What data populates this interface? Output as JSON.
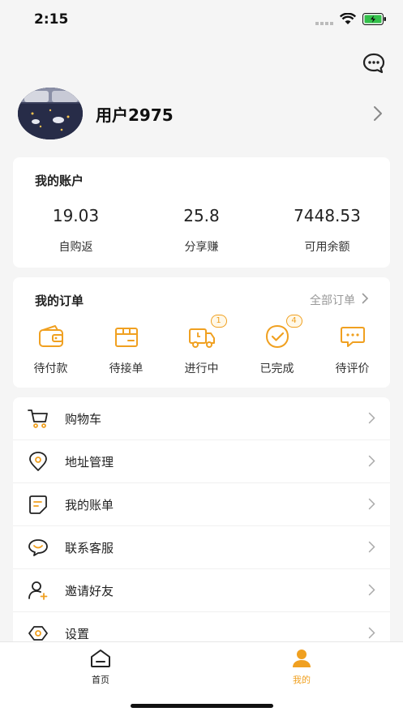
{
  "status": {
    "time": "2:15"
  },
  "profile": {
    "username": "用户2975"
  },
  "account": {
    "title": "我的账户",
    "stats": [
      {
        "value": "19.03",
        "label": "自购返"
      },
      {
        "value": "25.8",
        "label": "分享赚"
      },
      {
        "value": "7448.53",
        "label": "可用余额"
      }
    ]
  },
  "orders": {
    "title": "我的订单",
    "all_label": "全部订单",
    "items": [
      {
        "label": "待付款",
        "icon": "wallet-icon",
        "badge": ""
      },
      {
        "label": "待接单",
        "icon": "box-icon",
        "badge": ""
      },
      {
        "label": "进行中",
        "icon": "truck-icon",
        "badge": "1"
      },
      {
        "label": "已完成",
        "icon": "check-badge-icon",
        "badge": "4"
      },
      {
        "label": "待评价",
        "icon": "comment-icon",
        "badge": ""
      }
    ]
  },
  "menu": {
    "items": [
      {
        "label": "购物车",
        "icon": "cart-icon"
      },
      {
        "label": "地址管理",
        "icon": "location-icon"
      },
      {
        "label": "我的账单",
        "icon": "bill-icon"
      },
      {
        "label": "联系客服",
        "icon": "customer-service-icon"
      },
      {
        "label": "邀请好友",
        "icon": "invite-friend-icon"
      },
      {
        "label": "设置",
        "icon": "settings-icon"
      }
    ]
  },
  "tabbar": {
    "tabs": [
      {
        "label": "首页",
        "icon": "home-icon",
        "active": false
      },
      {
        "label": "我的",
        "icon": "profile-icon",
        "active": true
      }
    ]
  },
  "colors": {
    "accent": "#f0a020",
    "text": "#222222",
    "muted": "#999999",
    "background": "#f5f5f5"
  }
}
